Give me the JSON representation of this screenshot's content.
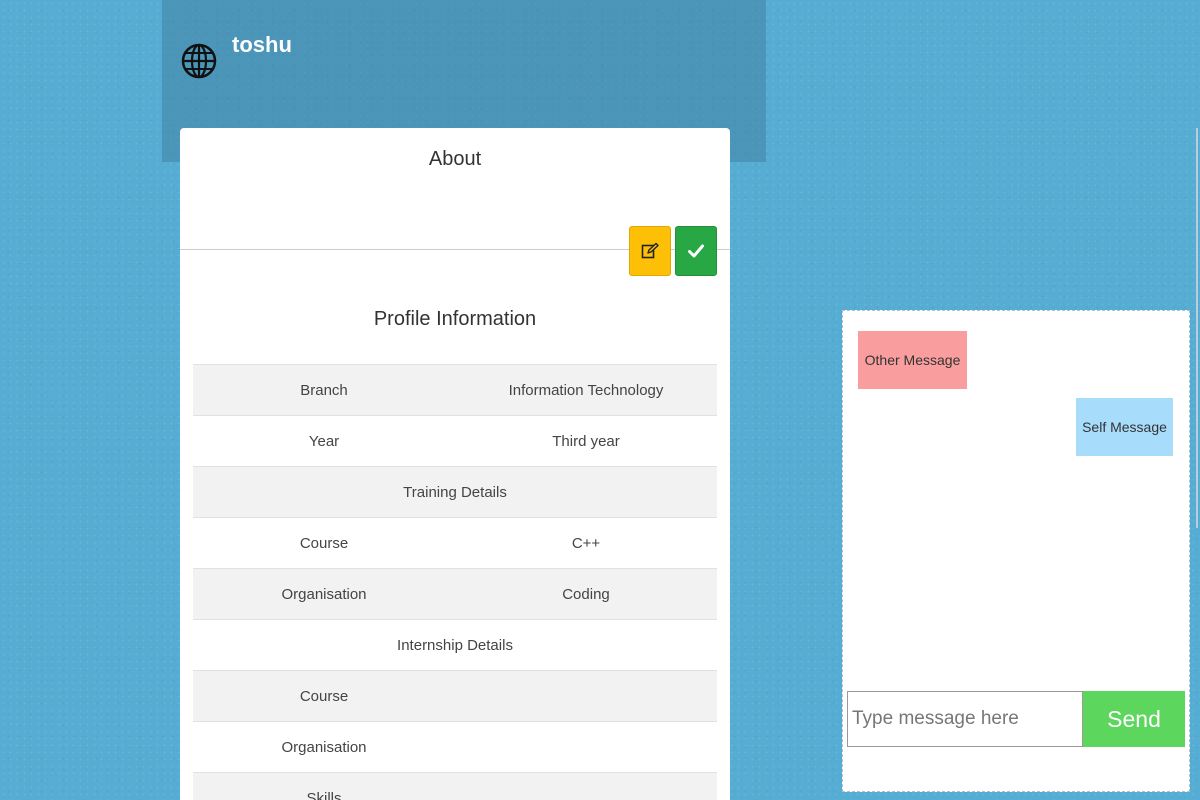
{
  "header": {
    "username": "toshu",
    "icon": "globe-icon"
  },
  "card": {
    "about_title": "About",
    "edit_icon": "edit-icon",
    "check_icon": "check-icon",
    "profile_title": "Profile Information",
    "rows": [
      {
        "label": "Branch",
        "value": "Information Technology"
      },
      {
        "label": "Year",
        "value": "Third year"
      },
      {
        "heading": "Training Details"
      },
      {
        "label": "Course",
        "value": "C++"
      },
      {
        "label": "Organisation",
        "value": "Coding"
      },
      {
        "heading": "Internship Details"
      },
      {
        "label": "Course",
        "value": ""
      },
      {
        "label": "Organisation",
        "value": ""
      },
      {
        "label": "Skills",
        "value": ""
      }
    ]
  },
  "chat": {
    "other_message": "Other Message",
    "self_message": "Self Message",
    "input_placeholder": "Type message here",
    "send_label": "Send"
  },
  "colors": {
    "background": "#56add3",
    "edit_button": "#fdc007",
    "check_button": "#28a745",
    "other_message": "#f99d9e",
    "self_message": "#a7dcfb",
    "send_button": "#5cd65c"
  }
}
